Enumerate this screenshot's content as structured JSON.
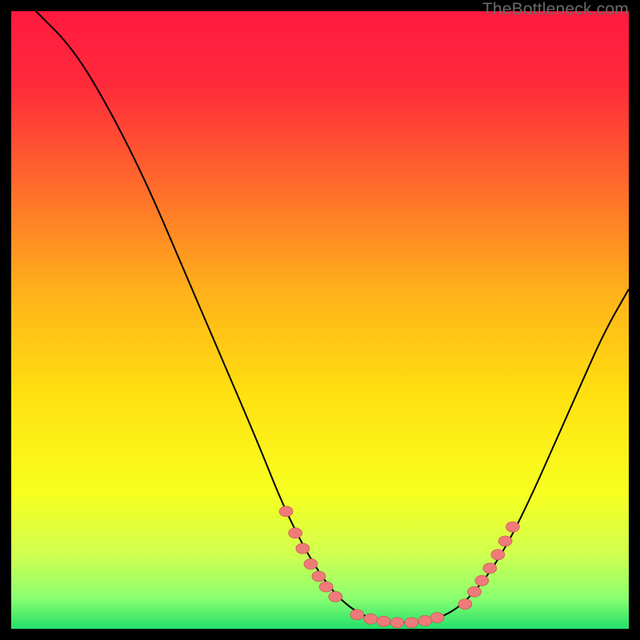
{
  "watermark": "TheBottleneck.com",
  "colors": {
    "bg": "#000000",
    "gradient_stops": [
      {
        "offset": 0.0,
        "color": "#ff1a3f"
      },
      {
        "offset": 0.12,
        "color": "#ff2a3a"
      },
      {
        "offset": 0.28,
        "color": "#ff6a2c"
      },
      {
        "offset": 0.45,
        "color": "#ffb01a"
      },
      {
        "offset": 0.62,
        "color": "#ffe010"
      },
      {
        "offset": 0.78,
        "color": "#f7ff20"
      },
      {
        "offset": 0.88,
        "color": "#d0ff50"
      },
      {
        "offset": 0.95,
        "color": "#8cff70"
      },
      {
        "offset": 1.0,
        "color": "#22e06a"
      }
    ],
    "curve": "#000000",
    "bead_fill": "#ef7a7a",
    "bead_stroke": "#c24d4d"
  },
  "chart_data": {
    "type": "line",
    "title": "",
    "xlabel": "",
    "ylabel": "",
    "xlim": [
      0,
      100
    ],
    "ylim": [
      0,
      100
    ],
    "grid": false,
    "curve": [
      {
        "x": 4,
        "y": 100
      },
      {
        "x": 10,
        "y": 94
      },
      {
        "x": 16,
        "y": 84
      },
      {
        "x": 22,
        "y": 72
      },
      {
        "x": 28,
        "y": 58
      },
      {
        "x": 34,
        "y": 44
      },
      {
        "x": 40,
        "y": 30
      },
      {
        "x": 44,
        "y": 20
      },
      {
        "x": 48,
        "y": 12
      },
      {
        "x": 52,
        "y": 6
      },
      {
        "x": 56,
        "y": 2.5
      },
      {
        "x": 60,
        "y": 1.2
      },
      {
        "x": 64,
        "y": 1.0
      },
      {
        "x": 68,
        "y": 1.3
      },
      {
        "x": 72,
        "y": 3
      },
      {
        "x": 76,
        "y": 7
      },
      {
        "x": 80,
        "y": 13
      },
      {
        "x": 84,
        "y": 21
      },
      {
        "x": 88,
        "y": 30
      },
      {
        "x": 92,
        "y": 39
      },
      {
        "x": 96,
        "y": 48
      },
      {
        "x": 100,
        "y": 55
      }
    ],
    "beads_left": [
      {
        "x": 44.5,
        "y": 19
      },
      {
        "x": 46.0,
        "y": 15.5
      },
      {
        "x": 47.2,
        "y": 13
      },
      {
        "x": 48.5,
        "y": 10.5
      },
      {
        "x": 49.8,
        "y": 8.5
      },
      {
        "x": 51.0,
        "y": 6.8
      },
      {
        "x": 52.5,
        "y": 5.2
      }
    ],
    "beads_bottom": [
      {
        "x": 56.0,
        "y": 2.3
      },
      {
        "x": 58.2,
        "y": 1.6
      },
      {
        "x": 60.3,
        "y": 1.2
      },
      {
        "x": 62.5,
        "y": 1.0
      },
      {
        "x": 64.8,
        "y": 1.0
      },
      {
        "x": 67.0,
        "y": 1.3
      },
      {
        "x": 69.0,
        "y": 1.8
      }
    ],
    "beads_right": [
      {
        "x": 73.5,
        "y": 4.0
      },
      {
        "x": 75.0,
        "y": 6.0
      },
      {
        "x": 76.2,
        "y": 7.8
      },
      {
        "x": 77.5,
        "y": 9.8
      },
      {
        "x": 78.8,
        "y": 12.0
      },
      {
        "x": 80.0,
        "y": 14.2
      },
      {
        "x": 81.2,
        "y": 16.5
      }
    ]
  }
}
